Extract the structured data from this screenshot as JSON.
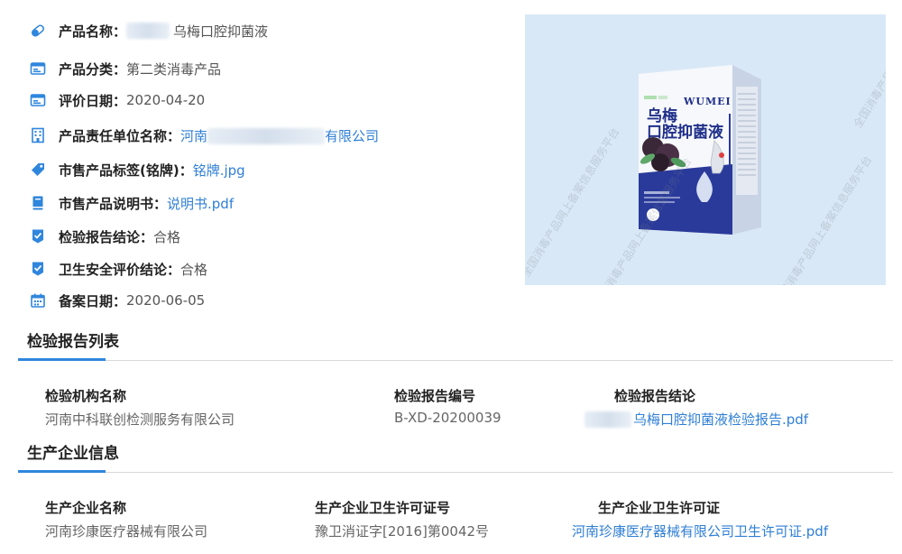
{
  "product": {
    "name_label": "产品名称：",
    "name_value": "乌梅口腔抑菌液",
    "category_label": "产品分类：",
    "category_value": "第二类消毒产品",
    "eval_date_label": "评价日期：",
    "eval_date_value": "2020-04-20",
    "company_label": "产品责任单位名称：",
    "company_prefix": "河南",
    "company_suffix": "有限公司",
    "tag_label": "市售产品标签(铭牌)：",
    "tag_link": "铭牌.jpg",
    "manual_label": "市售产品说明书：",
    "manual_link": "说明书.pdf",
    "report_label": "检验报告结论：",
    "report_value": "合格",
    "safety_label": "卫生安全评价结论：",
    "safety_value": "合格",
    "filing_label": "备案日期：",
    "filing_value": "2020-06-05"
  },
  "icons": {
    "name": "pill-icon",
    "category": "card-icon",
    "eval_date": "card-icon",
    "company": "building-icon",
    "tag": "tag-icon",
    "manual": "book-icon",
    "report": "check-badge-icon",
    "safety": "check-badge-icon",
    "filing": "calendar-icon"
  },
  "image": {
    "box_cn_1": "乌梅",
    "box_cn_2": "口腔抑菌液",
    "box_en": "WUMEI",
    "watermark": "全国消毒产品网上备案信息服务平台"
  },
  "inspection": {
    "title": "检验报告列表",
    "headers": [
      "检验机构名称",
      "检验报告编号",
      "检验报告结论"
    ],
    "row": {
      "org": "河南中科联创检测服务有限公司",
      "number": "B-XD-20200039",
      "conclusion_link": "乌梅口腔抑菌液检验报告.pdf"
    }
  },
  "manufacturer": {
    "title": "生产企业信息",
    "headers": [
      "生产企业名称",
      "生产企业卫生许可证号",
      "生产企业卫生许可证"
    ],
    "row": {
      "name": "河南珍康医疗器械有限公司",
      "license_no": "豫卫消证字[2016]第0042号",
      "license_link": "河南珍康医疗器械有限公司卫生许可证.pdf"
    }
  },
  "colors": {
    "accent": "#2f86dd",
    "link": "#2f7fd6",
    "icon": "#2f86dd"
  }
}
